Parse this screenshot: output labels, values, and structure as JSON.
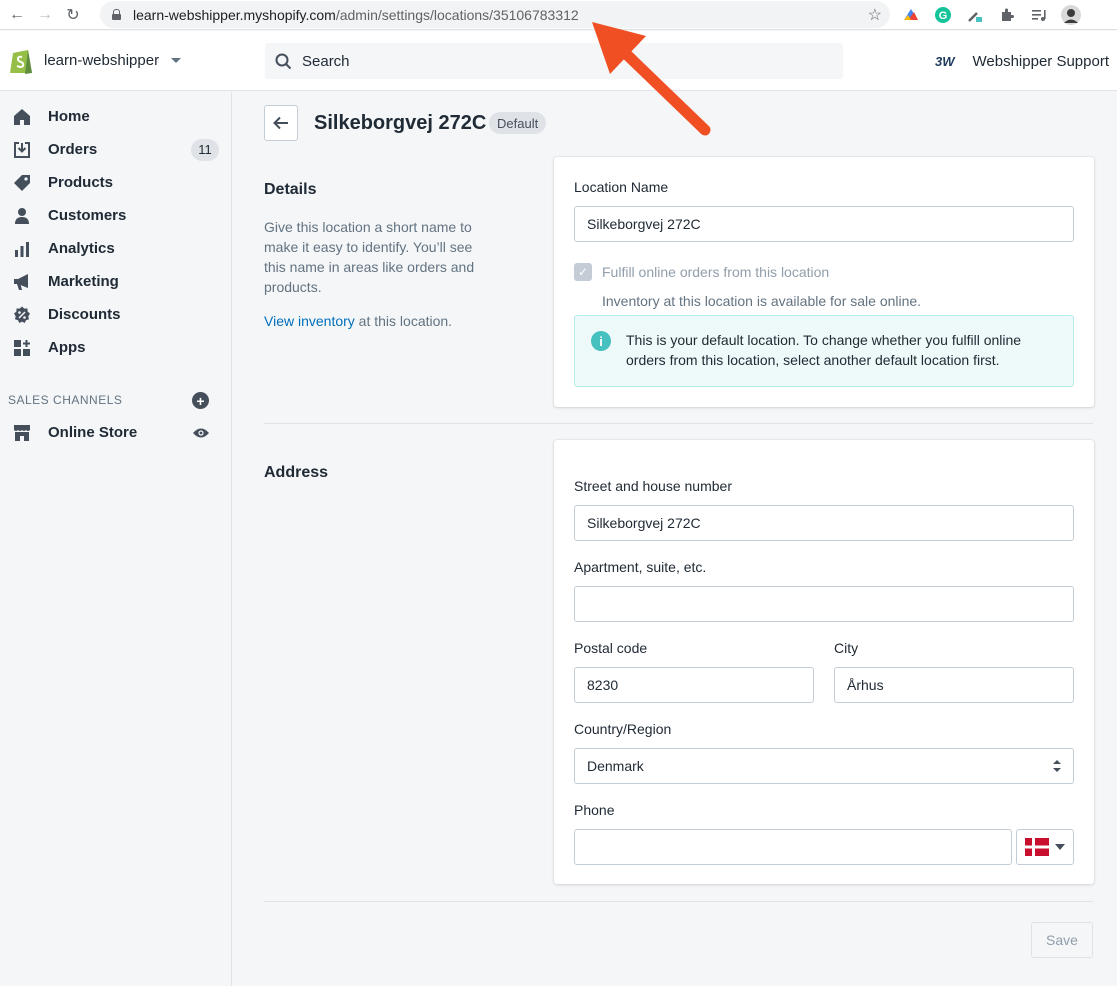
{
  "browser": {
    "url_host": "learn-webshipper.myshopify.com",
    "url_path": "/admin/settings/locations/35106783312"
  },
  "topbar": {
    "store_name": "learn-webshipper",
    "search_placeholder": "Search",
    "support_name": "Webshipper Support",
    "support_logo_text": "3W"
  },
  "sidebar": {
    "items": [
      {
        "label": "Home",
        "icon": "home-icon"
      },
      {
        "label": "Orders",
        "icon": "orders-icon",
        "badge": "11"
      },
      {
        "label": "Products",
        "icon": "tag-icon"
      },
      {
        "label": "Customers",
        "icon": "person-icon"
      },
      {
        "label": "Analytics",
        "icon": "bar-chart-icon"
      },
      {
        "label": "Marketing",
        "icon": "megaphone-icon"
      },
      {
        "label": "Discounts",
        "icon": "discount-icon"
      },
      {
        "label": "Apps",
        "icon": "apps-icon"
      }
    ],
    "channels_heading": "SALES CHANNELS",
    "online_store": "Online Store"
  },
  "page": {
    "title": "Silkeborgvej 272C",
    "badge": "Default"
  },
  "details": {
    "title": "Details",
    "description": "Give this location a short name to make it easy to identify. You’ll see this name in areas like orders and products.",
    "link_text": "View inventory",
    "link_suffix": " at this location.",
    "location_name_label": "Location Name",
    "location_name_value": "Silkeborgvej 272C",
    "fulfill_label": "Fulfill online orders from this location",
    "fulfill_checked": true,
    "inventory_help": "Inventory at this location is available for sale online.",
    "banner_text": "This is your default location. To change whether you fulfill online orders from this location, select another default location first."
  },
  "address": {
    "title": "Address",
    "street_label": "Street and house number",
    "street_value": "Silkeborgvej 272C",
    "apartment_label": "Apartment, suite, etc.",
    "apartment_value": "",
    "postal_label": "Postal code",
    "postal_value": "8230",
    "city_label": "City",
    "city_value": "Århus",
    "country_label": "Country/Region",
    "country_value": "Denmark",
    "phone_label": "Phone",
    "phone_value": ""
  },
  "actions": {
    "save_label": "Save"
  },
  "colors": {
    "link": "#006fbb",
    "banner_bg": "#eef9f9",
    "annotation_arrow": "#f04e23",
    "flag_red": "#c8102e"
  }
}
